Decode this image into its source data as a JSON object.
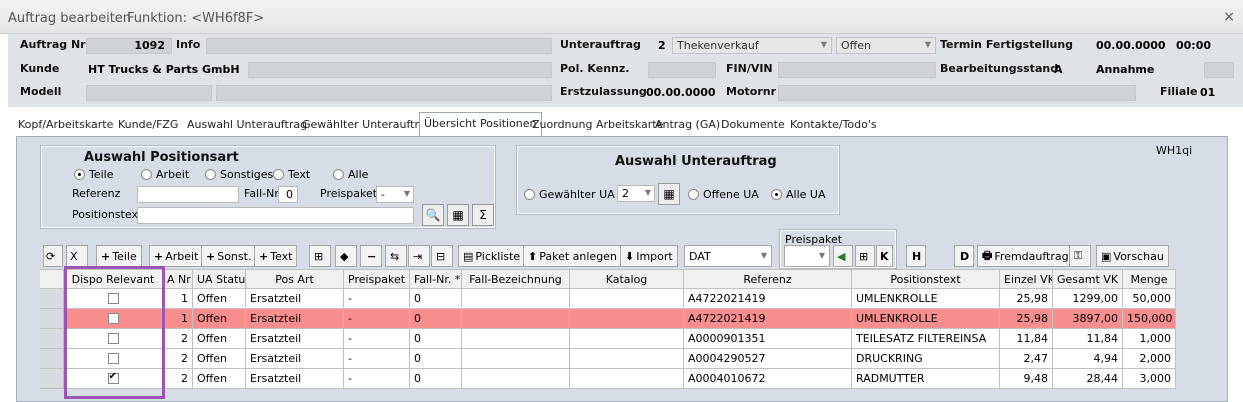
{
  "window": {
    "title": "Auftrag bearbeiten",
    "function": "Funktion: <WH6f8F>",
    "close": "×"
  },
  "header": {
    "auftrag_nr_label": "Auftrag Nr",
    "auftrag_nr": "1092",
    "info_label": "Info",
    "unterauftrag_label": "Unterauftrag",
    "unterauftrag_nr": "2",
    "unterauftrag_type": "Thekenverkauf",
    "unterauftrag_status": "Offen",
    "termin_label": "Termin Fertigstellung",
    "termin_date": "00.00.0000",
    "termin_time": "00:00",
    "kunde_label": "Kunde",
    "kunde": "HT Trucks & Parts GmbH",
    "pol_kennz_label": "Pol. Kennz.",
    "fin_label": "FIN/VIN",
    "bearbeitungsstand_label": "Bearbeitungsstand",
    "bearbeitungsstand": "A",
    "annahme": "Annahme",
    "modell_label": "Modell",
    "erstzulassung_label": "Erstzulassung",
    "erstzulassung": "00.00.0000",
    "motornr_label": "Motornr",
    "filiale_label": "Filiale",
    "filiale": "01"
  },
  "tabs": [
    "Kopf/Arbeitskarte",
    "Kunde/FZG",
    "Auswahl Unterauftrag",
    "Gewählter Unterauftrag",
    "Übersicht Positionen",
    "Zuordnung Arbeitskarte",
    "Antrag (GA)",
    "Dokumente",
    "Kontakte/Todo's"
  ],
  "code": "WH1qi",
  "positionsart": {
    "title": "Auswahl Positionsart",
    "options": [
      "Teile",
      "Arbeit",
      "Sonstiges",
      "Text",
      "Alle"
    ],
    "selected": "Teile",
    "referenz_label": "Referenz",
    "fall_nr_label": "Fall-Nr.",
    "fall_nr": "0",
    "preispaket_label": "Preispaket",
    "preispaket": "-",
    "positionstext_label": "Positionstext"
  },
  "unterauftrag": {
    "title": "Auswahl Unterauftrag",
    "options": [
      "Gewählter UA",
      "Offene UA",
      "Alle UA"
    ],
    "selected": "Alle UA",
    "ua_value": "2"
  },
  "toolbar": {
    "teile": "Teile",
    "arbeit": "Arbeit",
    "sonst": "Sonst.",
    "text": "Text",
    "pickliste": "Pickliste",
    "paket_anlegen": "Paket anlegen",
    "import": "Import",
    "import_format": "DAT",
    "preispaket_label": "Preispaket",
    "k": "K",
    "h": "H",
    "d": "D",
    "fremdauftrag": "Fremdauftrag",
    "vorschau": "Vorschau"
  },
  "table": {
    "columns": [
      "Dispo Relevant",
      "A Nr",
      "UA Status",
      "Pos Art",
      "Preispaket *",
      "Fall-Nr. *",
      "Fall-Bezeichnung",
      "Katalog",
      "Referenz",
      "Positionstext",
      "Einzel VK",
      "Gesamt VK",
      "Menge"
    ],
    "rows": [
      {
        "dispo": false,
        "ua_nr": "1",
        "status": "Offen",
        "pos_art": "Ersatzteil",
        "preispaket": "-",
        "fall_nr": "0",
        "fall_bez": "",
        "katalog": "",
        "referenz": "A4722021419",
        "text": "UMLENKROLLE",
        "einzel": "25,98",
        "gesamt": "1299,00",
        "menge": "50,000"
      },
      {
        "dispo": false,
        "ua_nr": "1",
        "status": "Offen",
        "pos_art": "Ersatzteil",
        "preispaket": "-",
        "fall_nr": "0",
        "fall_bez": "",
        "katalog": "",
        "referenz": "A4722021419",
        "text": "UMLENKROLLE",
        "einzel": "25,98",
        "gesamt": "3897,00",
        "menge": "150,000"
      },
      {
        "dispo": false,
        "ua_nr": "2",
        "status": "Offen",
        "pos_art": "Ersatzteil",
        "preispaket": "-",
        "fall_nr": "0",
        "fall_bez": "",
        "katalog": "",
        "referenz": "A0000901351",
        "text": "TEILESATZ FILTEREINSA",
        "einzel": "11,84",
        "gesamt": "11,84",
        "menge": "1,000"
      },
      {
        "dispo": false,
        "ua_nr": "2",
        "status": "Offen",
        "pos_art": "Ersatzteil",
        "preispaket": "-",
        "fall_nr": "0",
        "fall_bez": "",
        "katalog": "",
        "referenz": "A0004290527",
        "text": "DRUCKRING",
        "einzel": "2,47",
        "gesamt": "4,94",
        "menge": "2,000"
      },
      {
        "dispo": true,
        "ua_nr": "2",
        "status": "Offen",
        "pos_art": "Ersatzteil",
        "preispaket": "-",
        "fall_nr": "0",
        "fall_bez": "",
        "katalog": "",
        "referenz": "A0004010672",
        "text": "RADMUTTER",
        "einzel": "9,48",
        "gesamt": "28,44",
        "menge": "3,000"
      }
    ],
    "highlight_row": 1,
    "highlight_color": "#f88e8e"
  },
  "annotation_color": "#9b55b5"
}
